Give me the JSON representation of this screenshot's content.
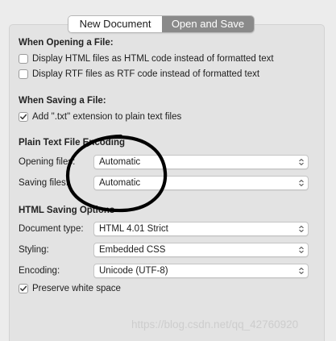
{
  "tabs": [
    {
      "label": "New Document",
      "active": false
    },
    {
      "label": "Open and Save",
      "active": true
    }
  ],
  "opening": {
    "heading": "When Opening a File:",
    "options": [
      {
        "label": "Display HTML files as HTML code instead of formatted text",
        "checked": false
      },
      {
        "label": "Display RTF files as RTF code instead of formatted text",
        "checked": false
      }
    ]
  },
  "saving": {
    "heading": "When Saving a File:",
    "options": [
      {
        "label": "Add \".txt\" extension to plain text files",
        "checked": true
      }
    ]
  },
  "encoding_section": {
    "heading": "Plain Text File Encoding",
    "opening_label": "Opening files:",
    "opening_value": "Automatic",
    "saving_label": "Saving files:",
    "saving_value": "Automatic"
  },
  "html_section": {
    "heading": "HTML Saving Options",
    "doctype_label": "Document type:",
    "doctype_value": "HTML 4.01 Strict",
    "styling_label": "Styling:",
    "styling_value": "Embedded CSS",
    "encoding_label": "Encoding:",
    "encoding_value": "Unicode (UTF-8)",
    "preserve_label": "Preserve white space",
    "preserve_checked": true
  },
  "watermark": "https://blog.csdn.net/qq_42760920",
  "colors": {
    "active_tab": "#8a8a8a",
    "annotation_stroke": "#000000"
  },
  "icons": {
    "checkmark": "checkmark-icon",
    "popup_arrows": "updown-chevron-icon"
  }
}
